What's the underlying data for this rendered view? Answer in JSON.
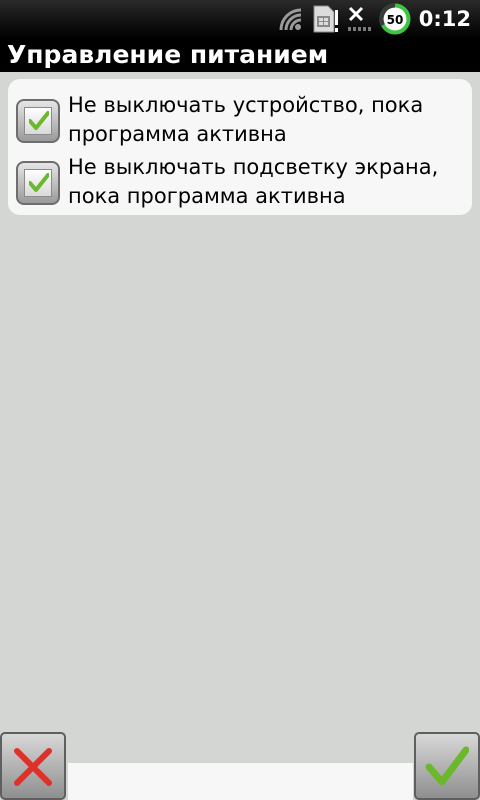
{
  "status_bar": {
    "time": "0:12",
    "battery_level": "50",
    "icons": [
      "wifi-icon",
      "sim-card-icon",
      "no-signal-icon",
      "battery-icon"
    ],
    "battery_accent": "#3ec43e"
  },
  "title_bar": {
    "title": "Управление питанием"
  },
  "options": [
    {
      "label": "Не выключать устройство, пока программа активна",
      "checked": true
    },
    {
      "label": "Не выключать подсветку экрана, пока программа активна",
      "checked": true
    }
  ],
  "bottom_bar": {
    "cancel_icon": "close-icon",
    "ok_icon": "checkmark-icon",
    "cancel_color": "#e0302a",
    "ok_color": "#6cb82c"
  }
}
